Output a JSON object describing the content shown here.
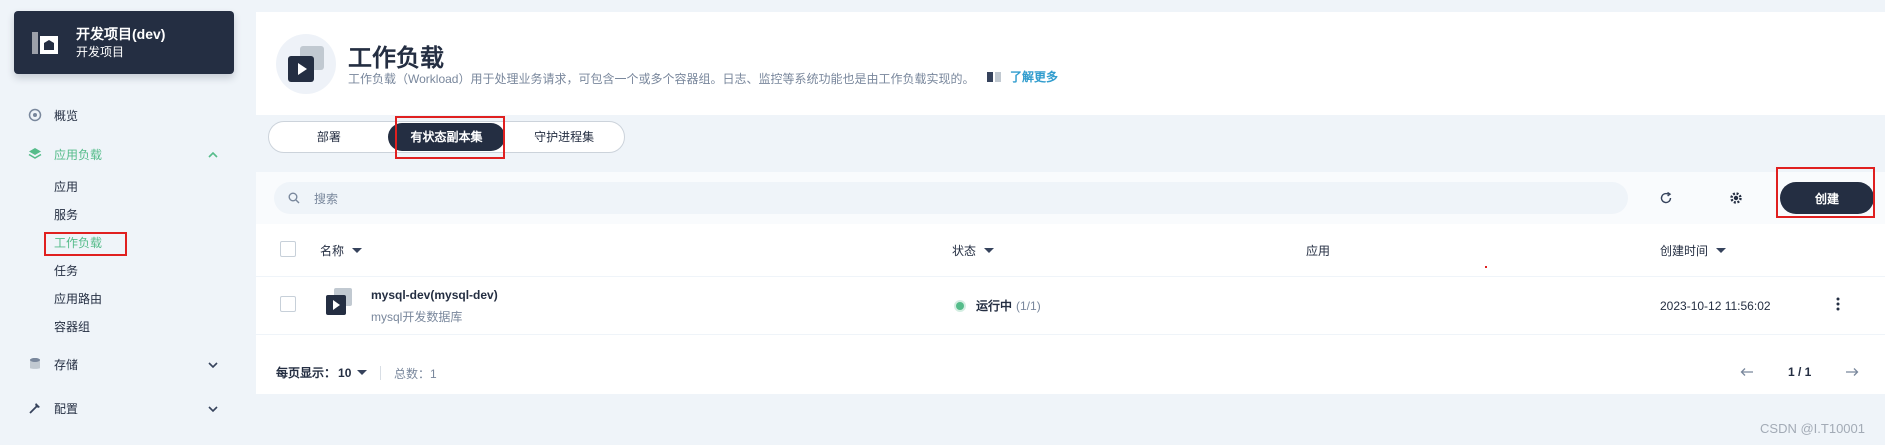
{
  "project": {
    "title": "开发项目(dev)",
    "subtitle": "开发项目"
  },
  "sidebar": {
    "overview": "概览",
    "app_workloads": "应用负载",
    "sub_items": [
      "应用",
      "服务",
      "工作负载",
      "任务",
      "应用路由",
      "容器组"
    ],
    "storage": "存储",
    "config": "配置"
  },
  "header": {
    "title": "工作负载",
    "description": "工作负载（Workload）用于处理业务请求，可包含一个或多个容器组。日志、监控等系统功能也是由工作负载实现的。",
    "learn_more": "了解更多"
  },
  "tabs": [
    {
      "label": "部署",
      "active": false
    },
    {
      "label": "有状态副本集",
      "active": true
    },
    {
      "label": "守护进程集",
      "active": false
    }
  ],
  "toolbar": {
    "search_placeholder": "搜索",
    "create_label": "创建"
  },
  "table": {
    "columns": [
      "名称",
      "状态",
      "应用",
      "创建时间"
    ],
    "rows": [
      {
        "name": "mysql-dev(mysql-dev)",
        "description": "mysql开发数据库",
        "status": "运行中",
        "status_count": "(1/1)",
        "app": "",
        "created": "2023-10-12 11:56:02"
      }
    ]
  },
  "pagination": {
    "per_page_label": "每页显示：",
    "per_page_value": "10",
    "total_label": "总数：",
    "total_value": "1",
    "page": "1 / 1"
  },
  "watermark": "CSDN @I.T10001",
  "colors": {
    "accent_green": "#55bc8a",
    "dark": "#242e42",
    "link": "#329dce",
    "highlight_red": "#e02020"
  },
  "icons": [
    "project-icon",
    "overview-icon",
    "app-workloads-icon",
    "chevron-up-icon",
    "chevron-down-icon",
    "storage-icon",
    "config-icon",
    "workload-icon",
    "book-icon",
    "search-icon",
    "refresh-icon",
    "gear-icon",
    "caret-down-icon",
    "more-icon",
    "arrow-left-icon",
    "arrow-right-icon"
  ]
}
